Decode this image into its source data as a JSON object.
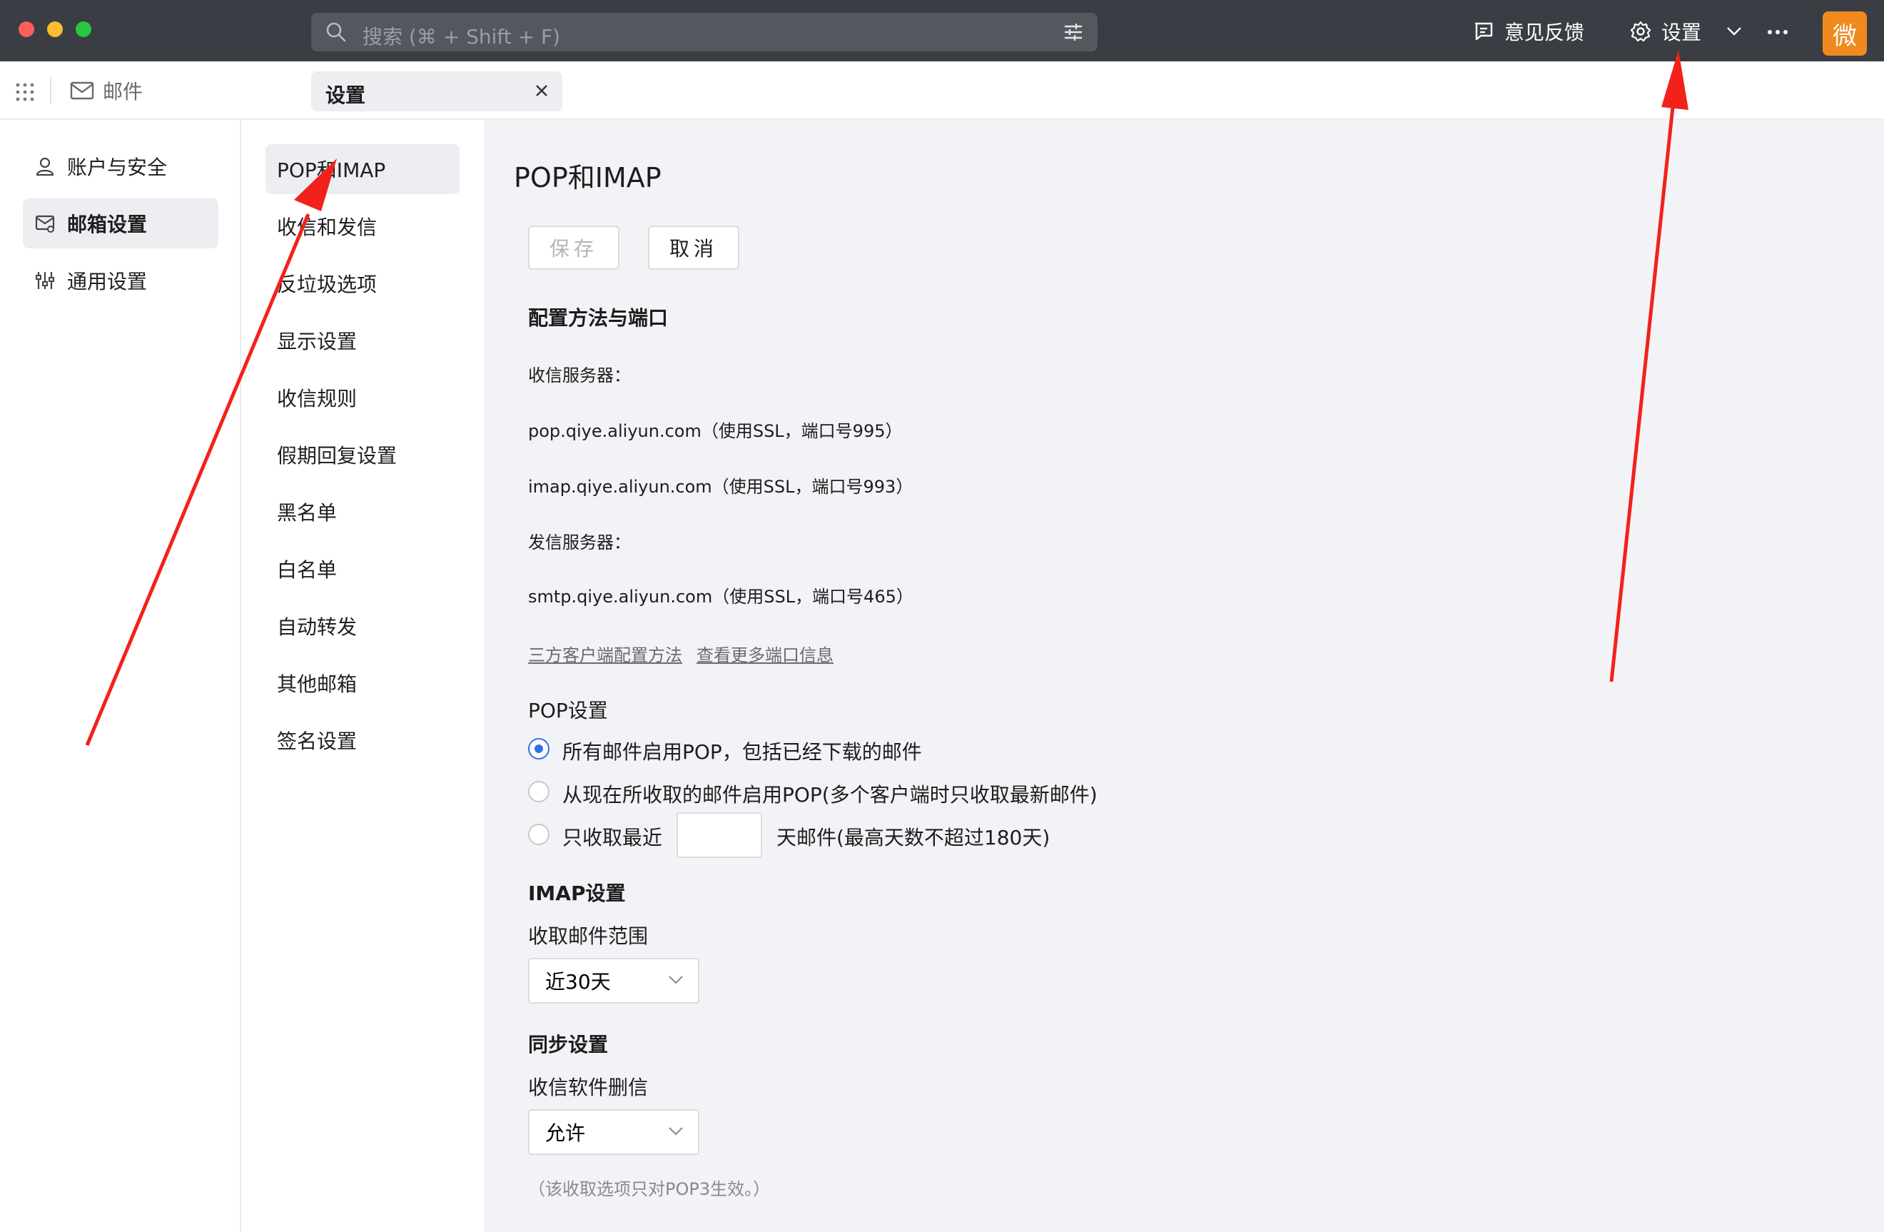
{
  "titlebar": {
    "search_placeholder": "搜索 (⌘ + Shift + F)",
    "feedback_label": "意见反馈",
    "settings_label": "设置",
    "avatar_text": "微"
  },
  "tabs": {
    "mail_label": "邮件",
    "active_tab": "设置"
  },
  "nav_primary": [
    {
      "label": "账户与安全",
      "icon": "user-icon"
    },
    {
      "label": "邮箱设置",
      "icon": "mailbox-settings-icon"
    },
    {
      "label": "通用设置",
      "icon": "sliders-icon"
    }
  ],
  "nav_secondary": [
    "POP和IMAP",
    "收信和发信",
    "反垃圾选项",
    "显示设置",
    "收信规则",
    "假期回复设置",
    "黑名单",
    "白名单",
    "自动转发",
    "其他邮箱",
    "签名设置"
  ],
  "main": {
    "title": "POP和IMAP",
    "save_label": "保存",
    "cancel_label": "取消",
    "config_heading": "配置方法与端口",
    "incoming_label": "收信服务器：",
    "pop_server": "pop.qiye.aliyun.com（使用SSL，端口号995）",
    "imap_server": "imap.qiye.aliyun.com（使用SSL，端口号993）",
    "outgoing_label": "发信服务器：",
    "smtp_server": "smtp.qiye.aliyun.com（使用SSL，端口号465）",
    "link_third_party": "三方客户端配置方法",
    "link_more_ports": "查看更多端口信息",
    "pop_heading": "POP设置",
    "pop_option_all": "所有邮件启用POP，包括已经下载的邮件",
    "pop_option_now": "从现在所收取的邮件启用POP(多个客户端时只收取最新邮件)",
    "pop_option_recent_prefix": "只收取最近",
    "pop_option_recent_suffix": "天邮件(最高天数不超过180天)",
    "pop_recent_days_value": "",
    "imap_heading": "IMAP设置",
    "imap_range_label": "收取邮件范围",
    "imap_range_value": "近30天",
    "sync_heading": "同步设置",
    "sync_delete_label": "收信软件删信",
    "sync_delete_value": "允许",
    "sync_hint": "（该收取选项只对POP3生效。）"
  },
  "colors": {
    "titlebar": "#3a3e44",
    "accent_blue": "#2f72e8",
    "avatar_orange": "#f08a1e",
    "annotation_red": "#f2221a"
  }
}
